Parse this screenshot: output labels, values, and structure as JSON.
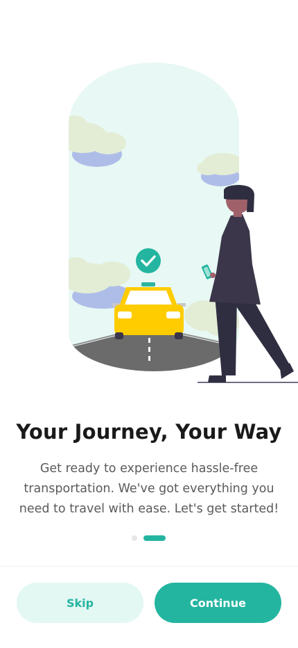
{
  "onboarding": {
    "title": "Your Journey, Your Way",
    "description": "Get ready to experience hassle-free transportation. We've got everything you need to travel with ease. Let's get started!",
    "page_indicator": {
      "total": 2,
      "current": 2
    },
    "skip_label": "Skip",
    "continue_label": "Continue"
  },
  "colors": {
    "accent": "#24b5a0",
    "accent_light": "#e3f7f3",
    "taxi_yellow": "#ffcc00",
    "figure_dark": "#3b3649"
  },
  "icons": [
    "check-circle-icon",
    "taxi-illustration",
    "woman-with-phone-illustration"
  ]
}
